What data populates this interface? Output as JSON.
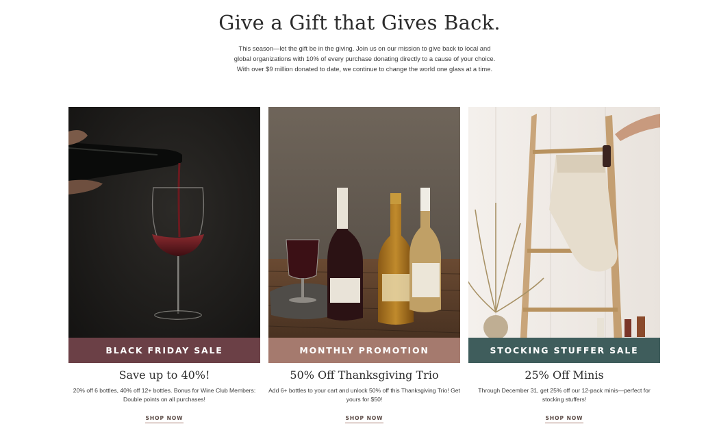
{
  "hero": {
    "title": "Give a Gift that Gives Back.",
    "body": "This season—let the gift be in the giving. Join us on our mission to give back to local and global organizations with 10% of every purchase donating directly to a cause of your choice. With over $9 million donated to date, we continue to change the world one glass at a time."
  },
  "cards": [
    {
      "banner": "BLACK FRIDAY SALE",
      "banner_color": "#6b4046",
      "title": "Save up to 40%!",
      "description": "20% off 6 bottles, 40% off 12+ bottles. Bonus for Wine Club Members: Double points on all purchases!",
      "cta": "SHOP NOW"
    },
    {
      "banner": "MONTHLY PROMOTION",
      "banner_color": "#a57a6e",
      "title": "50% Off Thanksgiving Trio",
      "description": "Add 6+ bottles to your cart and unlock 50% off this Thanksgiving Trio! Get yours for $50!",
      "cta": "SHOP NOW"
    },
    {
      "banner": "STOCKING STUFFER SALE",
      "banner_color": "#3f5d5c",
      "title": "25% Off Minis",
      "description": "Through December 31, get 25% off our 12-pack minis—perfect for stocking stuffers!",
      "cta": "SHOP NOW"
    }
  ]
}
